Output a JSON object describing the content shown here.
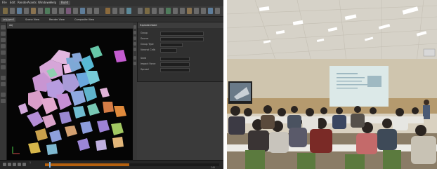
{
  "left_app": {
    "menu": [
      "File",
      "Edit",
      "Render",
      "Assets",
      "Windows",
      "Help"
    ],
    "desktop": "Build",
    "tabs": [
      "/obj/geo1",
      "Scene View",
      "Render View",
      "Composite View"
    ],
    "viewport_path": "obj",
    "param_panel": {
      "title": "Explode-Node",
      "rows": [
        "Group",
        "Source",
        "Group Type",
        "Voronoi Cells",
        "Seed",
        "Impact Force",
        "Spread"
      ]
    },
    "timeline": {
      "start": "1",
      "end": "240",
      "current_frame": 1
    }
  },
  "right_photo": {
    "slide_text": "",
    "description": "lecture-hall"
  }
}
